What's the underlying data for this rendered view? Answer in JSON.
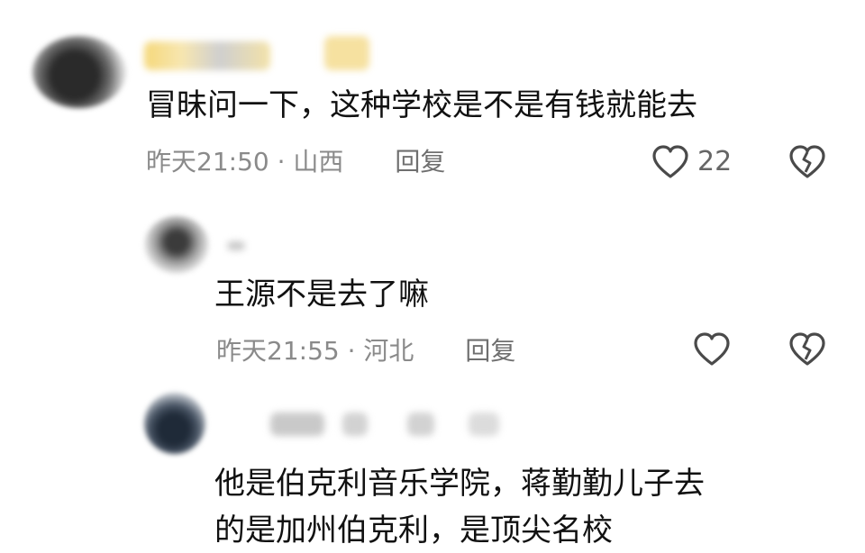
{
  "comments": [
    {
      "text": "冒昧问一下，这种学校是不是有钱就能去",
      "time": "昨天21:50 · 山西",
      "reply": "回复",
      "likes": "22"
    },
    {
      "text": "王源不是去了嘛",
      "time": "昨天21:55 · 河北",
      "reply": "回复"
    },
    {
      "text_line1": "他是伯克利音乐学院，蒋勤勤儿子去",
      "text_line2": "的是加州伯克利，是顶尖名校"
    }
  ],
  "icons": {
    "like": "heart-outline-icon",
    "dislike": "broken-heart-icon"
  }
}
